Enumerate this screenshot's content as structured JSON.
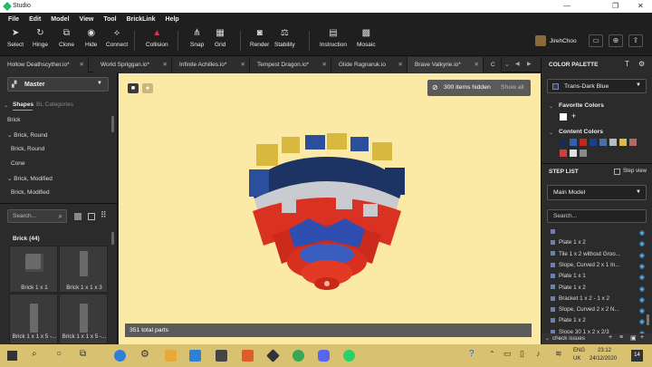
{
  "window": {
    "title": "Studio"
  },
  "menu": [
    "File",
    "Edit",
    "Model",
    "View",
    "Tool",
    "BrickLink",
    "Help"
  ],
  "toolbar": {
    "select": "Select",
    "hinge": "Hinge",
    "clone": "Clone",
    "hide": "Hide",
    "connect": "Connect",
    "collision": "Collision",
    "snap": "Snap",
    "grid": "Grid",
    "render": "Render",
    "stability": "Stability",
    "instruction": "Instruction",
    "mosaic": "Mosaic",
    "user": "JirehChoo"
  },
  "tabs": [
    "Hollow Deathscyther.io*",
    "World Spriggan.io*",
    "Infinite Achilles.io*",
    "Tempest Dragon.io*",
    "Glide Ragnaruk.io",
    "Brave Valkyrie.io*",
    "C"
  ],
  "left": {
    "palette_dropdown": "Master",
    "tab_shapes": "Shapes",
    "tab_bl": "BL Categories",
    "categories": [
      "Brick",
      "Brick, Round",
      "Brick, Round",
      "Cone",
      "Brick, Modified",
      "Brick, Modified"
    ],
    "search_placeholder": "Search...",
    "group_label": "Brick (44)",
    "parts": [
      "Brick 1 x 1",
      "Brick 1 x 1 x 3",
      "Brick 1 x 1 x 5 -...",
      "Brick 1 x 1 x 5 -..."
    ]
  },
  "viewport": {
    "hidden_text": "300 items hidden",
    "show_all": "Show all",
    "total_parts": "351 total parts"
  },
  "right": {
    "color_palette": "COLOR PALETTE",
    "selected_color": "Trans-Dark Blue",
    "selected_color_hex": "#1a3f8c",
    "favorite_colors": "Favorite Colors",
    "content_colors": "Content Colors",
    "content_swatches": [
      "#1b2a4f",
      "#3060b8",
      "#c4281c",
      "#1a3f8c",
      "#4a6ea8",
      "#b7bcc4",
      "#d8b94a",
      "#b06a6a",
      "#d04040",
      "#e0e0e0",
      "#8a8a8a"
    ],
    "step_list": "STEP LIST",
    "step_view": "Step view",
    "model_dropdown": "Main Model",
    "search_placeholder": "Search...",
    "steps": [
      {
        "label": "",
        "warn": false
      },
      {
        "label": "Plate 1 x 2",
        "warn": false
      },
      {
        "label": "Tile 1 x 2 without Groo...",
        "warn": true
      },
      {
        "label": "Slope, Curved 2 x 1 In...",
        "warn": true
      },
      {
        "label": "Plate 1 x 1",
        "warn": false
      },
      {
        "label": "Plate 1 x 2",
        "warn": false
      },
      {
        "label": "Bracket 1 x 2 - 1 x 2",
        "warn": true
      },
      {
        "label": "Slope, Curved 2 x 2 N...",
        "warn": true
      },
      {
        "label": "Plate 1 x 2",
        "warn": false
      },
      {
        "label": "Slope 30 1 x 2 x 2/3",
        "warn": true
      }
    ],
    "check_issues": "check issues"
  },
  "taskbar": {
    "lang": "ENG",
    "region": "UK",
    "time": "23:12",
    "date": "24/12/2020",
    "notif": "14"
  }
}
